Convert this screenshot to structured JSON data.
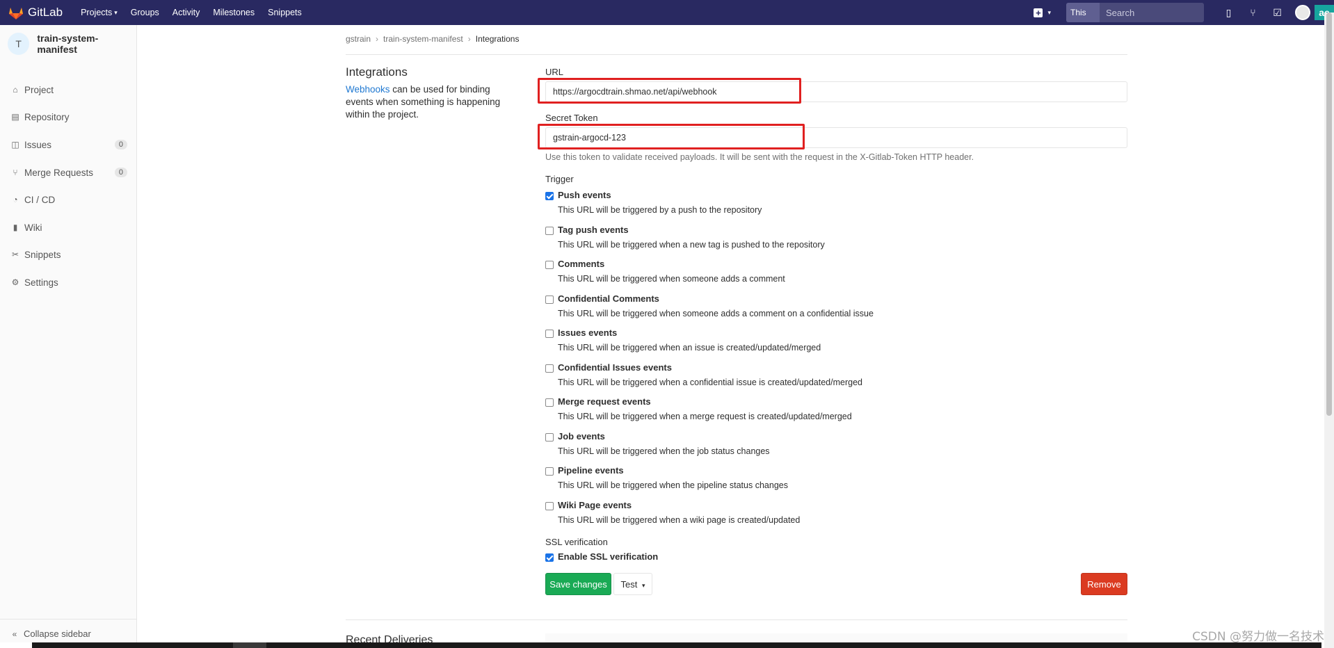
{
  "navbar": {
    "brand": "GitLab",
    "links": [
      {
        "label": "Projects",
        "caret": true
      },
      {
        "label": "Groups"
      },
      {
        "label": "Activity"
      },
      {
        "label": "Milestones"
      },
      {
        "label": "Snippets"
      }
    ],
    "search_scope": "This project",
    "search_placeholder": "Search",
    "right_badge": "ae"
  },
  "sidebar": {
    "project_initial": "T",
    "project_name": "train-system-manifest",
    "items": [
      {
        "label": "Project",
        "icon": "home-icon"
      },
      {
        "label": "Repository",
        "icon": "book-icon"
      },
      {
        "label": "Issues",
        "icon": "issues-icon",
        "count": "0"
      },
      {
        "label": "Merge Requests",
        "icon": "merge-icon",
        "count": "0"
      },
      {
        "label": "CI / CD",
        "icon": "rocket-icon"
      },
      {
        "label": "Wiki",
        "icon": "wiki-icon"
      },
      {
        "label": "Snippets",
        "icon": "scissors-icon"
      },
      {
        "label": "Settings",
        "icon": "gear-icon"
      }
    ],
    "collapse_label": "Collapse sidebar"
  },
  "breadcrumb": [
    "gstrain",
    "train-system-manifest",
    "Integrations"
  ],
  "settings": {
    "title": "Integrations",
    "desc_link": "Webhooks",
    "desc_text": " can be used for binding events when something is happening within the project."
  },
  "form": {
    "url_label": "URL",
    "url_value": "https://argocdtrain.shmao.net/api/webhook",
    "token_label": "Secret Token",
    "token_value": "gstrain-argocd-123",
    "token_help": "Use this token to validate received payloads. It will be sent with the request in the X-Gitlab-Token HTTP header.",
    "trigger_label": "Trigger",
    "triggers": [
      {
        "label": "Push events",
        "help": "This URL will be triggered by a push to the repository",
        "checked": true
      },
      {
        "label": "Tag push events",
        "help": "This URL will be triggered when a new tag is pushed to the repository",
        "checked": false
      },
      {
        "label": "Comments",
        "help": "This URL will be triggered when someone adds a comment",
        "checked": false
      },
      {
        "label": "Confidential Comments",
        "help": "This URL will be triggered when someone adds a comment on a confidential issue",
        "checked": false
      },
      {
        "label": "Issues events",
        "help": "This URL will be triggered when an issue is created/updated/merged",
        "checked": false
      },
      {
        "label": "Confidential Issues events",
        "help": "This URL will be triggered when a confidential issue is created/updated/merged",
        "checked": false
      },
      {
        "label": "Merge request events",
        "help": "This URL will be triggered when a merge request is created/updated/merged",
        "checked": false
      },
      {
        "label": "Job events",
        "help": "This URL will be triggered when the job status changes",
        "checked": false
      },
      {
        "label": "Pipeline events",
        "help": "This URL will be triggered when the pipeline status changes",
        "checked": false
      },
      {
        "label": "Wiki Page events",
        "help": "This URL will be triggered when a wiki page is created/updated",
        "checked": false
      }
    ],
    "ssl_label": "SSL verification",
    "ssl_checkbox_label": "Enable SSL verification",
    "ssl_checked": true,
    "save_label": "Save changes",
    "test_label": "Test",
    "remove_label": "Remove"
  },
  "recent_deliveries": "Recent Deliveries",
  "watermark": "CSDN @努力做一名技术",
  "colors": {
    "navbar": "#292961",
    "save": "#1aaa55",
    "remove": "#db3b21",
    "highlight": "#e02020",
    "link": "#1f78d1"
  }
}
